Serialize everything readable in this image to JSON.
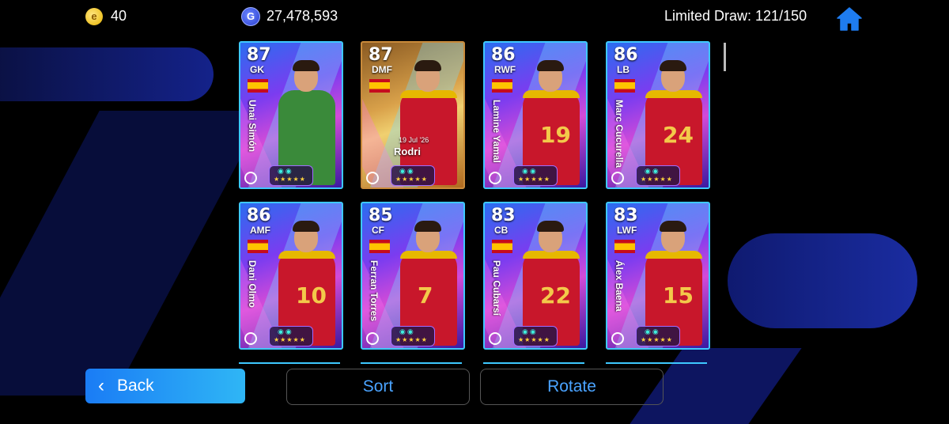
{
  "topbar": {
    "coins": "40",
    "coin_icon": "e",
    "gp": "27,478,593",
    "gp_icon": "G",
    "limited_draw": "Limited Draw: 121/150"
  },
  "cards": [
    {
      "rating": "87",
      "position": "GK",
      "name": "Unai Simón",
      "nation": "spain-flag",
      "kit": "green"
    },
    {
      "rating": "87",
      "position": "DMF",
      "name": "Rodri",
      "date": "19 Jul '26",
      "nation": "spain-flag",
      "special": true
    },
    {
      "rating": "86",
      "position": "RWF",
      "name": "Lamine Yamal",
      "number": "19",
      "nation": "spain-flag"
    },
    {
      "rating": "86",
      "position": "LB",
      "name": "Marc Cucurella",
      "number": "24",
      "nation": "spain-flag"
    },
    {
      "rating": "86",
      "position": "AMF",
      "name": "Dani Olmo",
      "number": "10",
      "nation": "spain-flag"
    },
    {
      "rating": "85",
      "position": "CF",
      "name": "Ferran Torres",
      "number": "7",
      "nation": "spain-flag"
    },
    {
      "rating": "83",
      "position": "CB",
      "name": "Pau Cubarsí",
      "number": "22",
      "nation": "spain-flag"
    },
    {
      "rating": "83",
      "position": "LWF",
      "name": "Álex Baena",
      "number": "15",
      "nation": "spain-flag"
    }
  ],
  "buttons": {
    "back": "Back",
    "sort": "Sort",
    "rotate": "Rotate"
  },
  "colors": {
    "accent": "#4aa3ff",
    "card_border": "#3ec8ff",
    "back_button": "#1a7cf5"
  }
}
